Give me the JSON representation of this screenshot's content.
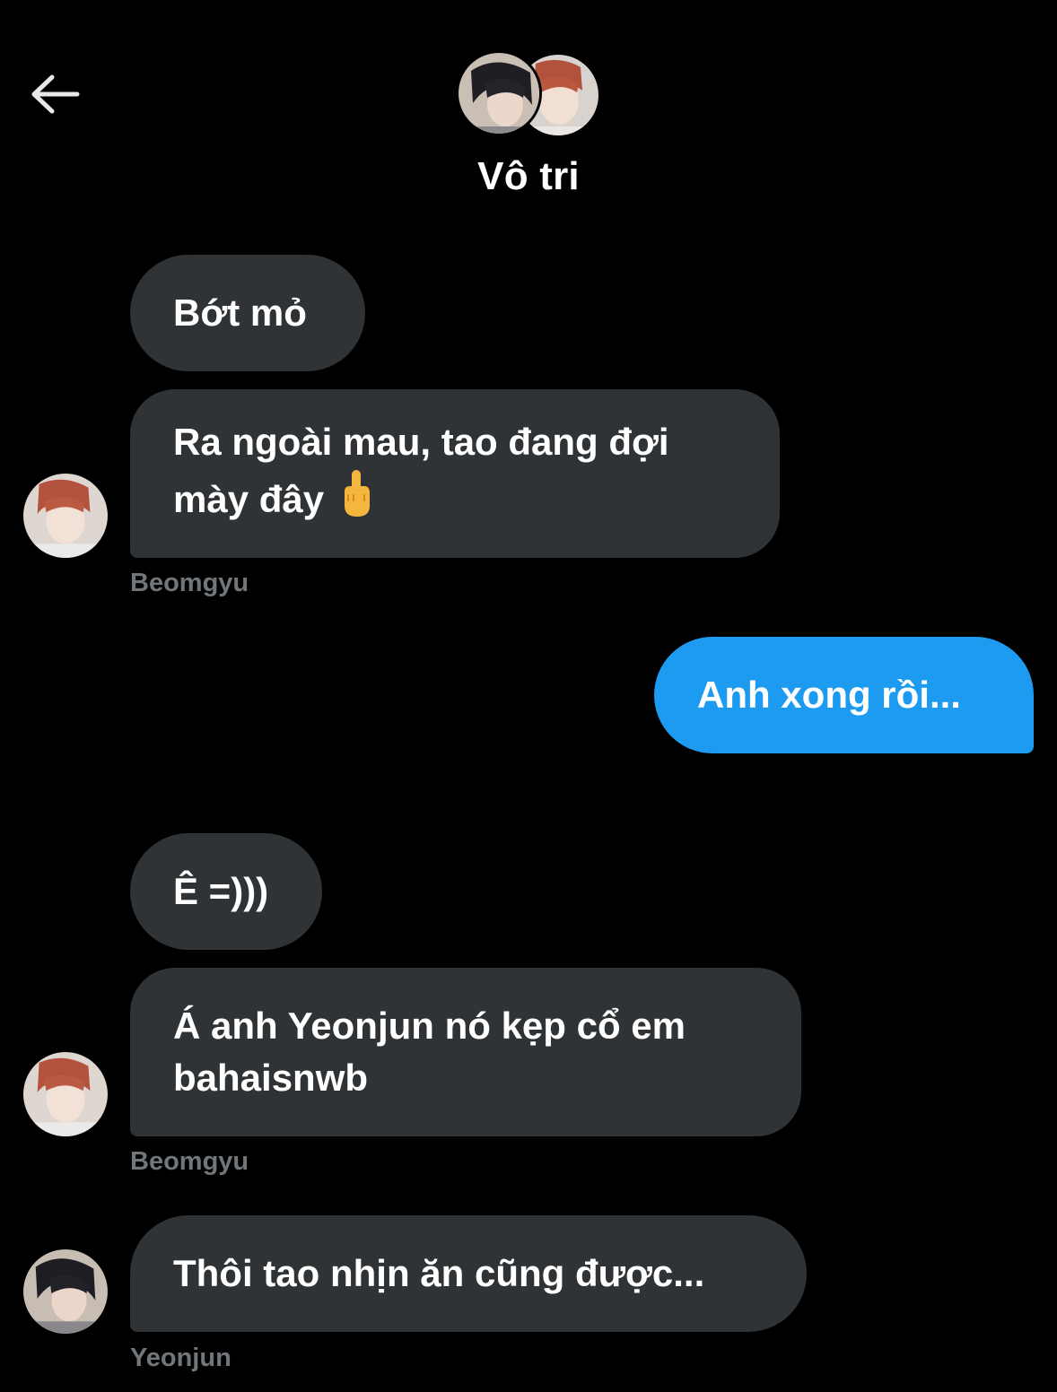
{
  "header": {
    "title": "Vô tri",
    "back_icon": "arrow-left-icon"
  },
  "colors": {
    "background": "#000000",
    "incoming_bubble": "#2f3336",
    "outgoing_bubble": "#1d9bf0",
    "sender_name": "#71767b"
  },
  "messages": [
    {
      "direction": "in",
      "text": "Bớt mỏ"
    },
    {
      "direction": "in",
      "text": "Ra ngoài mau, tao đang đợi",
      "text2": "mày đây",
      "emoji": "middle-finger-emoji",
      "sender": "Beomgyu"
    },
    {
      "direction": "out",
      "text": "Anh xong rồi..."
    },
    {
      "direction": "in",
      "text": "Ê =)))"
    },
    {
      "direction": "in",
      "text": "Á anh Yeonjun nó kẹp cổ em",
      "text2": "bahaisnwb",
      "sender": "Beomgyu"
    },
    {
      "direction": "in",
      "text": "Thôi tao nhịn ăn cũng được...",
      "sender": "Yeonjun"
    }
  ]
}
